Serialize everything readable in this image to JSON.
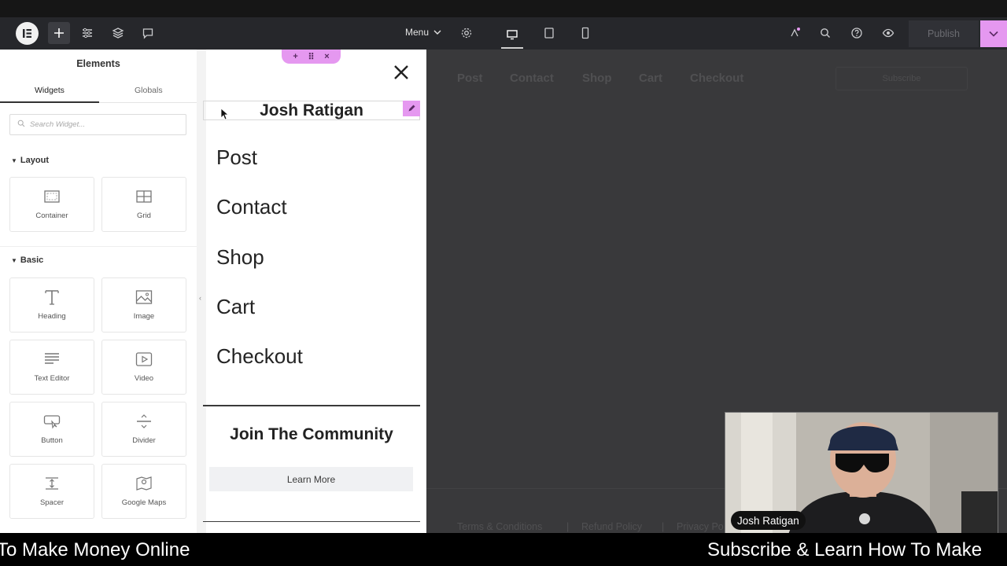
{
  "toolbar": {
    "menu_label": "Menu",
    "publish_label": "Publish"
  },
  "panel": {
    "title": "Elements",
    "tabs": [
      "Widgets",
      "Globals"
    ],
    "search_placeholder": "Search Widget...",
    "sections": [
      {
        "title": "Layout",
        "widgets": [
          "Container",
          "Grid"
        ]
      },
      {
        "title": "Basic",
        "widgets": [
          "Heading",
          "Image",
          "Text Editor",
          "Video",
          "Button",
          "Divider",
          "Spacer",
          "Google Maps"
        ]
      }
    ]
  },
  "offcanvas": {
    "site_name": "Josh Ratigan",
    "menu_items": [
      "Post",
      "Contact",
      "Shop",
      "Cart",
      "Checkout"
    ],
    "cta_heading": "Join The Community",
    "cta_button": "Learn More"
  },
  "canvas": {
    "nav_items": [
      "Post",
      "Contact",
      "Shop",
      "Cart",
      "Checkout"
    ],
    "subscribe_label": "Subscribe",
    "footer_links": [
      "Terms & Conditions",
      "|",
      "Refund Policy",
      "|",
      "Privacy Po"
    ]
  },
  "webcam": {
    "name": "Josh Ratigan"
  },
  "ticker": {
    "left_text": "To Make Money Online",
    "right_text": "Subscribe & Learn How To Make"
  },
  "colors": {
    "accent": "#e598f0",
    "toolbar_bg": "#26272b",
    "canvas_dim": "#39393b"
  }
}
